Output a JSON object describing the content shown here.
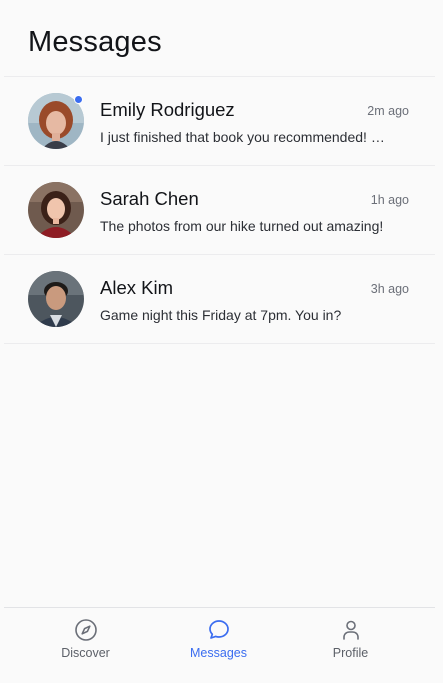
{
  "header": {
    "title": "Messages"
  },
  "accent_color": "#3b6df0",
  "conversations": [
    {
      "name": "Emily Rodriguez",
      "time": "2m ago",
      "preview": "I just finished that book you recommended! …",
      "unread": true,
      "avatar": "avatar-photo-woman-red-hair"
    },
    {
      "name": "Sarah Chen",
      "time": "1h ago",
      "preview": "The photos from our hike turned out amazing!",
      "unread": false,
      "avatar": "avatar-photo-woman-dark-hair-red-top"
    },
    {
      "name": "Alex Kim",
      "time": "3h ago",
      "preview": "Game night this Friday at 7pm. You in?",
      "unread": false,
      "avatar": "avatar-photo-man-dark-hair"
    }
  ],
  "tabbar": {
    "tabs": [
      {
        "label": "Discover",
        "icon": "compass-icon",
        "active": false
      },
      {
        "label": "Messages",
        "icon": "chat-bubble-icon",
        "active": true
      },
      {
        "label": "Profile",
        "icon": "person-icon",
        "active": false
      }
    ]
  }
}
